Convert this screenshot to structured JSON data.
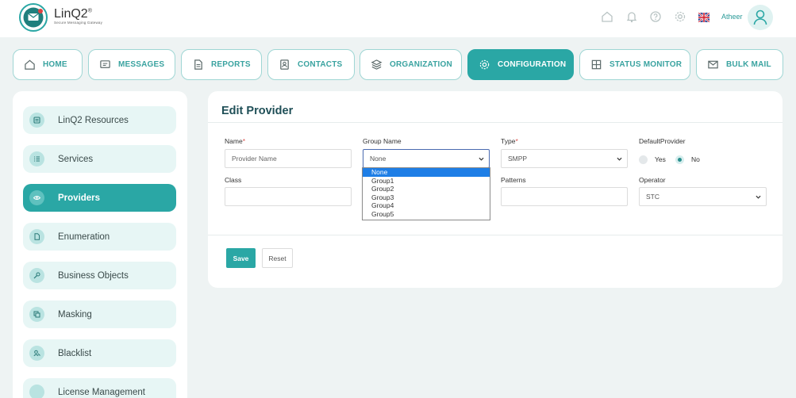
{
  "app": {
    "logo_name": "LinQ2",
    "logo_mark": "®",
    "logo_tagline": "Secure Messaging Gateway",
    "username": "Atheer"
  },
  "header_icons": [
    "home-icon",
    "bell-icon",
    "help-icon",
    "gear-icon",
    "uk-flag-icon",
    "user-avatar-icon"
  ],
  "nav": {
    "tabs": [
      {
        "label": "HOME",
        "icon": "home-icon"
      },
      {
        "label": "MESSAGES",
        "icon": "message-icon"
      },
      {
        "label": "REPORTS",
        "icon": "document-icon"
      },
      {
        "label": "CONTACTS",
        "icon": "contact-card-icon"
      },
      {
        "label": "ORGANIZATION",
        "icon": "layers-icon"
      },
      {
        "label": "CONFIGURATION",
        "icon": "gear-icon"
      },
      {
        "label": "STATUS MONITOR",
        "icon": "grid-icon"
      },
      {
        "label": "BULK MAIL",
        "icon": "mail-icon"
      }
    ],
    "active": "CONFIGURATION"
  },
  "sidebar": {
    "items": [
      {
        "label": "LinQ2 Resources"
      },
      {
        "label": "Services"
      },
      {
        "label": "Providers"
      },
      {
        "label": "Enumeration"
      },
      {
        "label": "Business Objects"
      },
      {
        "label": "Masking"
      },
      {
        "label": "Blacklist"
      },
      {
        "label": "License Management"
      }
    ],
    "active": "Providers"
  },
  "form": {
    "title": "Edit Provider",
    "name_label": "Name",
    "name_placeholder": "Provider Name",
    "group_label": "Group Name",
    "group_value": "None",
    "type_label": "Type",
    "type_value": "SMPP",
    "default_label": "DefaultProvider",
    "default_yes": "Yes",
    "default_no": "No",
    "default_selected": "No",
    "class_label": "Class",
    "patterns_label": "Patterns",
    "operator_label": "Operator",
    "operator_value": "STC",
    "required_mark": "*",
    "save_label": "Save",
    "reset_label": "Reset"
  },
  "group_dropdown": {
    "options": [
      "None",
      "Group1",
      "Group2",
      "Group3",
      "Group4",
      "Group5"
    ],
    "selected": "None"
  },
  "colors": {
    "accent": "#2aa7a5",
    "accent_light": "#e7f6f5",
    "title": "#1f4f57",
    "required": "#d9534f",
    "dropdown_highlight": "#1e7ee6"
  }
}
